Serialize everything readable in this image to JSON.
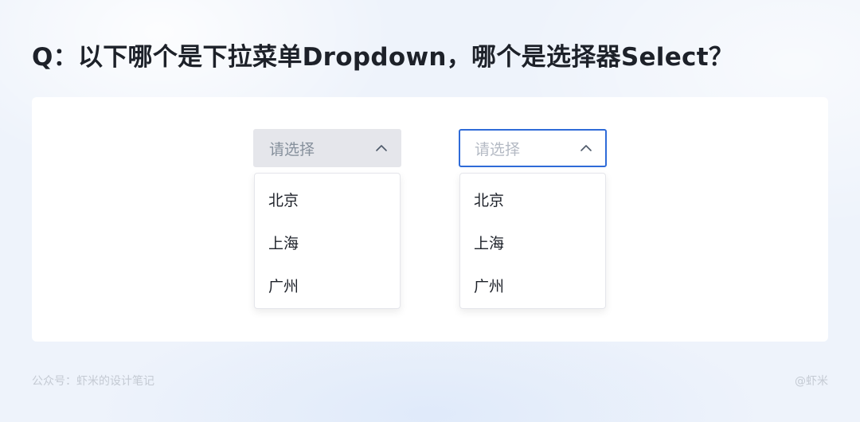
{
  "question": "Q：以下哪个是下拉菜单Dropdown，哪个是选择器Select？",
  "dropdown": {
    "placeholder": "请选择",
    "items": [
      "北京",
      "上海",
      "广州"
    ]
  },
  "select": {
    "placeholder": "请选择",
    "items": [
      "北京",
      "上海",
      "广州"
    ]
  },
  "footer": {
    "credit": "公众号：虾米的设计笔记",
    "handle": "@虾米"
  },
  "colors": {
    "accent": "#2f6bd8",
    "dropdown_trigger_bg": "#e5e6eb",
    "text_primary": "#1d2129",
    "background": "#eef3fb"
  },
  "icons": {
    "trigger_arrow": "chevron-up-icon"
  }
}
